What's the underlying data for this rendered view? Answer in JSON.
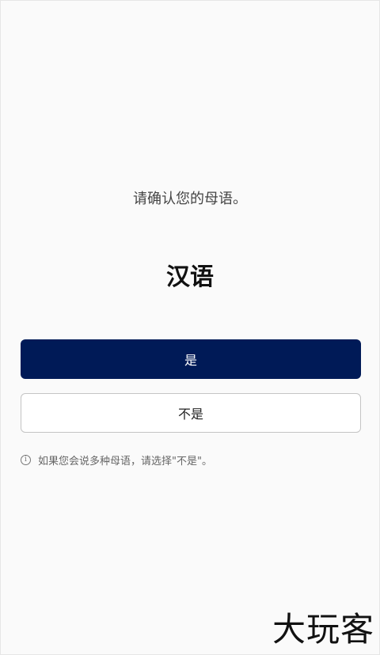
{
  "prompt": "请确认您的母语。",
  "language": "汉语",
  "buttons": {
    "yes_label": "是",
    "no_label": "不是"
  },
  "hint": {
    "icon": "info-icon",
    "text": "如果您会说多种母语，请选择\"不是\"。"
  },
  "watermark": "大玩客",
  "colors": {
    "primary": "#001a57",
    "background": "#fafafa"
  }
}
